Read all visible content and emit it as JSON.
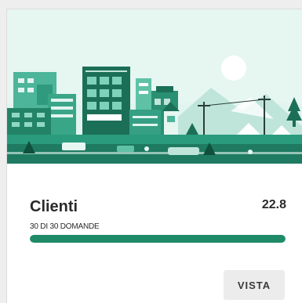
{
  "card": {
    "title": "Clienti",
    "score": "22.8",
    "progress": {
      "label": "30 DI 30 DOMANDE",
      "completed": 30,
      "total": 30,
      "fraction": 1.0
    },
    "view_button_label": "VISTA",
    "illustration": {
      "icon": "city-skyline-illustration"
    }
  },
  "colors": {
    "accent": "#1f8a68",
    "sky": "#dff3ee",
    "track": "#d7ece4"
  }
}
